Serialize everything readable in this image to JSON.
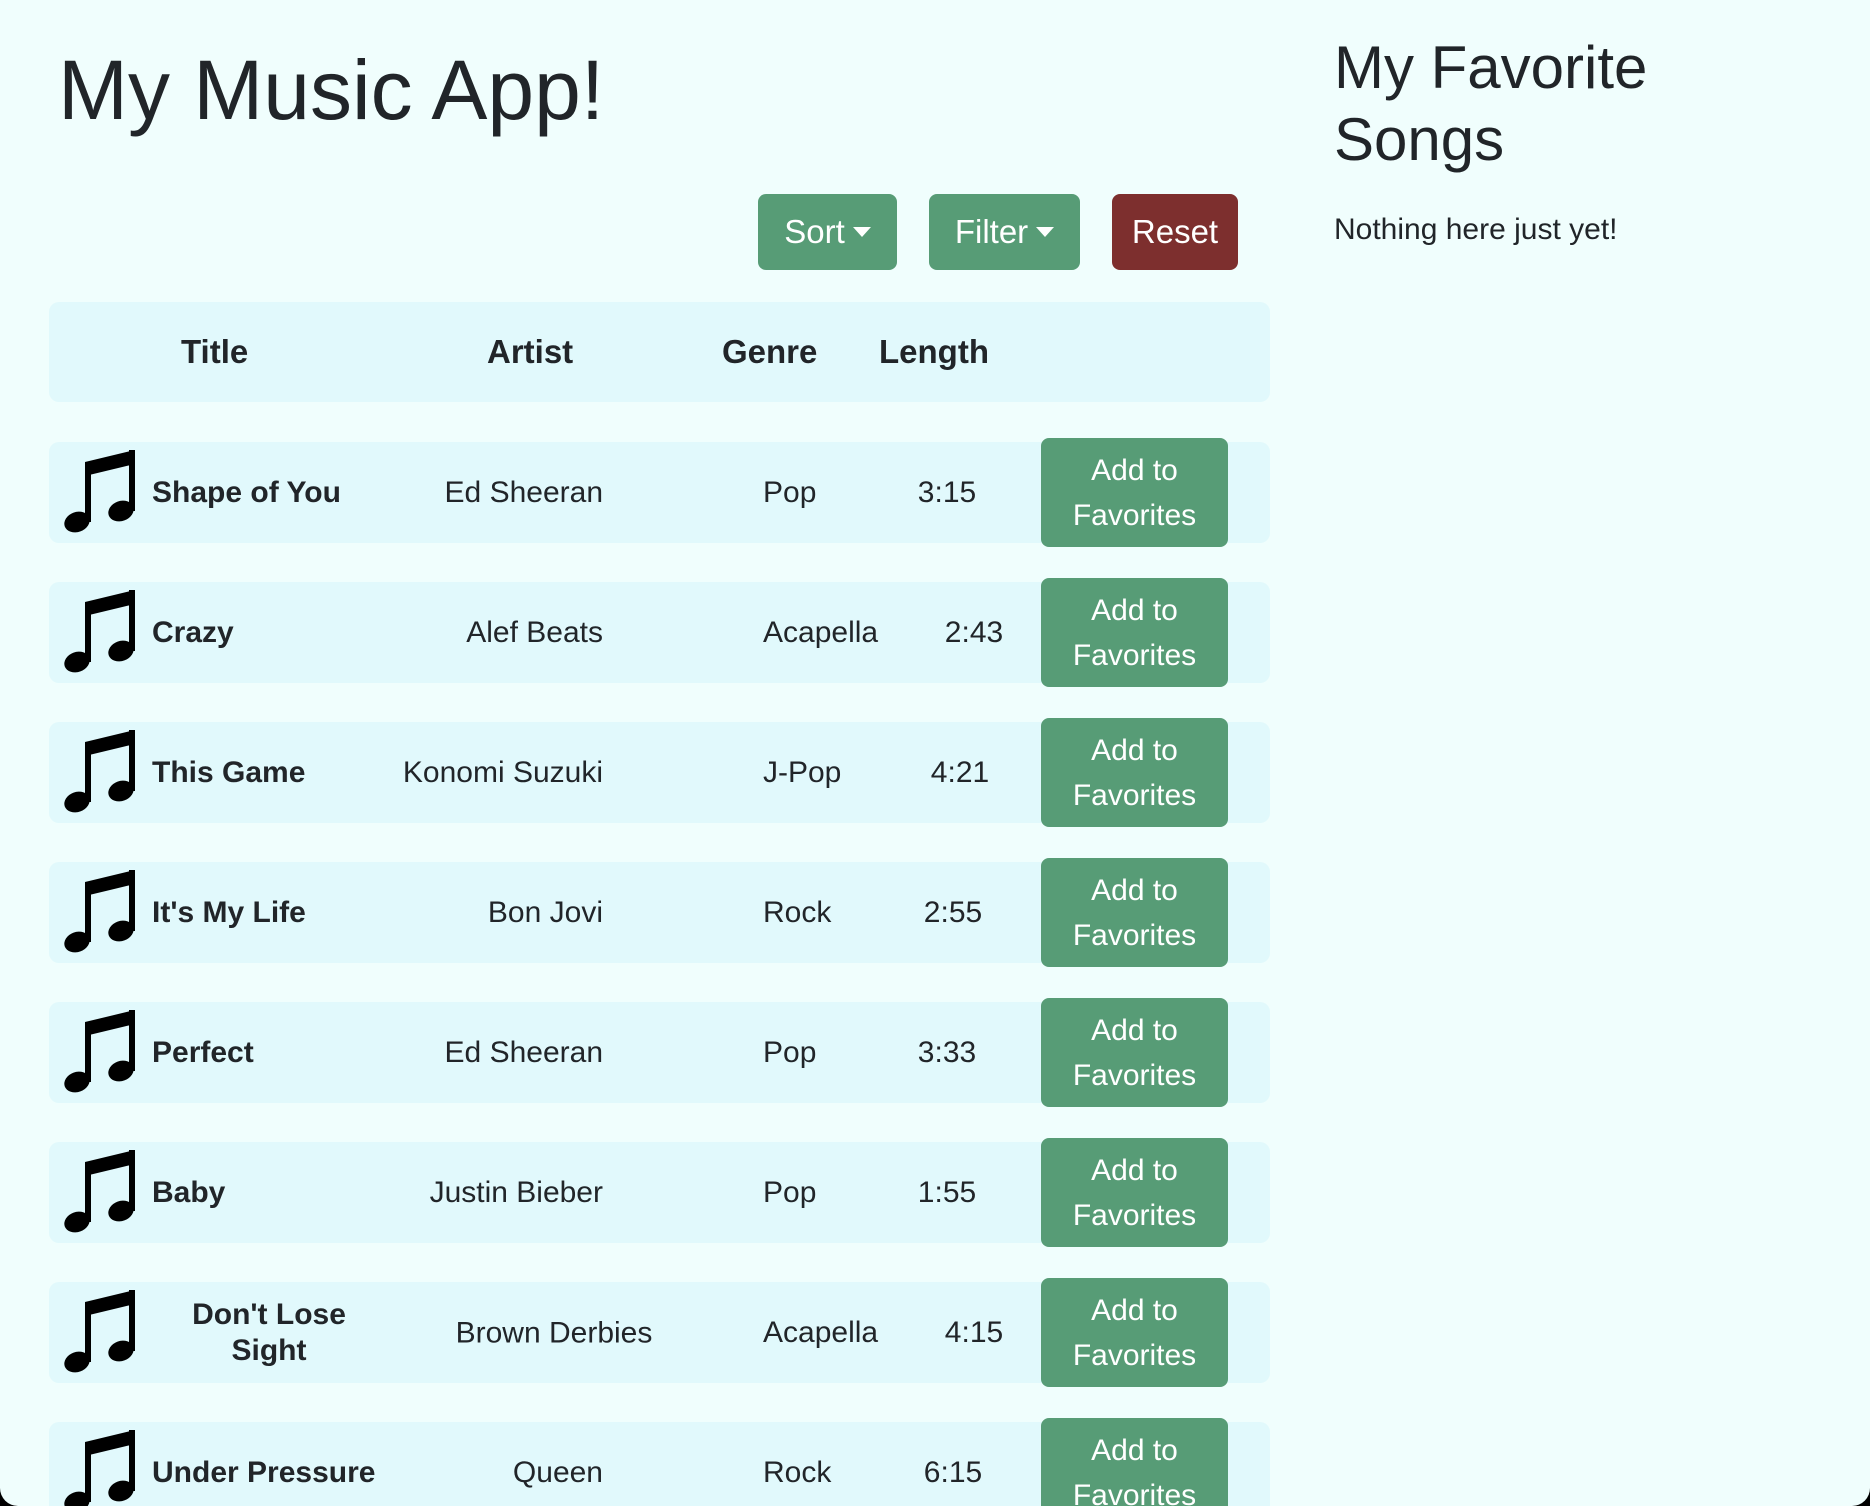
{
  "app": {
    "title": "My Music App!"
  },
  "favorites": {
    "title": "My Favorite Songs",
    "empty_text": "Nothing here just yet!"
  },
  "toolbar": {
    "sort_label": "Sort",
    "filter_label": "Filter",
    "reset_label": "Reset"
  },
  "table": {
    "headers": {
      "title": "Title",
      "artist": "Artist",
      "genre": "Genre",
      "length": "Length"
    },
    "add_label": "Add to Favorites",
    "rows": [
      {
        "title": "Shape of You",
        "artist": "Ed Sheeran",
        "genre": "Pop",
        "length": "3:15"
      },
      {
        "title": "Crazy",
        "artist": "Alef Beats",
        "genre": "Acapella",
        "length": "2:43"
      },
      {
        "title": "This Game",
        "artist": "Konomi Suzuki",
        "genre": "J-Pop",
        "length": "4:21"
      },
      {
        "title": "It's My Life",
        "artist": "Bon Jovi",
        "genre": "Rock",
        "length": "2:55"
      },
      {
        "title": "Perfect",
        "artist": "Ed Sheeran",
        "genre": "Pop",
        "length": "3:33"
      },
      {
        "title": "Baby",
        "artist": "Justin Bieber",
        "genre": "Pop",
        "length": "1:55"
      },
      {
        "title": "Don't Lose Sight",
        "artist": "Brown Derbies",
        "genre": "Acapella",
        "length": "4:15"
      },
      {
        "title": "Under Pressure",
        "artist": "Queen",
        "genre": "Rock",
        "length": "6:15"
      }
    ]
  },
  "icons": {
    "row_icon": "music-note-icon",
    "dropdown_icon": "caret-down-icon"
  },
  "colors": {
    "background": "#f0fefd",
    "row_background": "#e1f9fc",
    "accent_green": "#579c76",
    "reset_red": "#7d2f2e",
    "text": "#212529"
  }
}
